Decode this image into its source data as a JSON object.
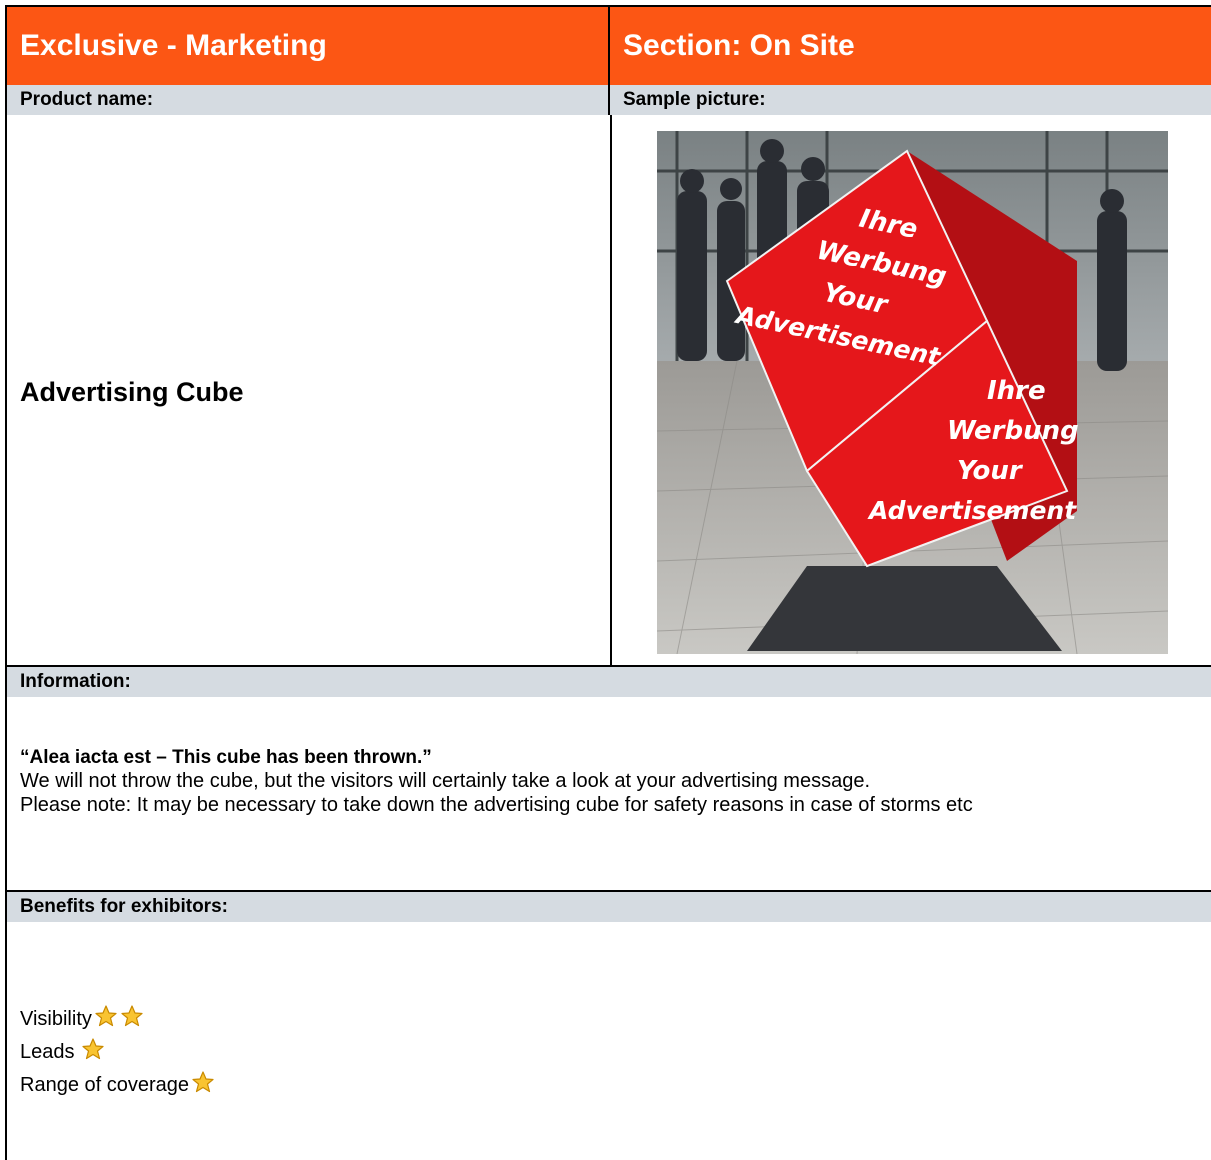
{
  "header": {
    "left_title": "Exclusive - Marketing",
    "right_title": "Section: On Site"
  },
  "labels": {
    "product_name": "Product name:",
    "sample_picture": "Sample picture:",
    "information": "Information:",
    "benefits": "Benefits for exhibitors:"
  },
  "product": {
    "name": "Advertising Cube"
  },
  "picture": {
    "cube_upper_lines": [
      "Ihre",
      "Werbung",
      "Your",
      "Advertisement"
    ],
    "cube_lower_lines": [
      "Ihre",
      "Werbung",
      "Your",
      "Advertisement"
    ],
    "cube_color": "#e5171b"
  },
  "information": {
    "quote": "“Alea iacta est – This cube has been thrown.”",
    "line1": "We will not throw the cube, but the visitors will certainly take a look at your advertising message.",
    "line2": "Please note: It may be necessary to take down the advertising cube for safety reasons in case of storms etc"
  },
  "benefits": [
    {
      "label": "Visibility",
      "stars": 2
    },
    {
      "label": "Leads",
      "stars": 1
    },
    {
      "label": "Range of coverage",
      "stars": 1
    }
  ],
  "colors": {
    "header_bg": "#fc5614",
    "label_bar_bg": "#d5dbe1",
    "star_fill": "#f9c431"
  }
}
